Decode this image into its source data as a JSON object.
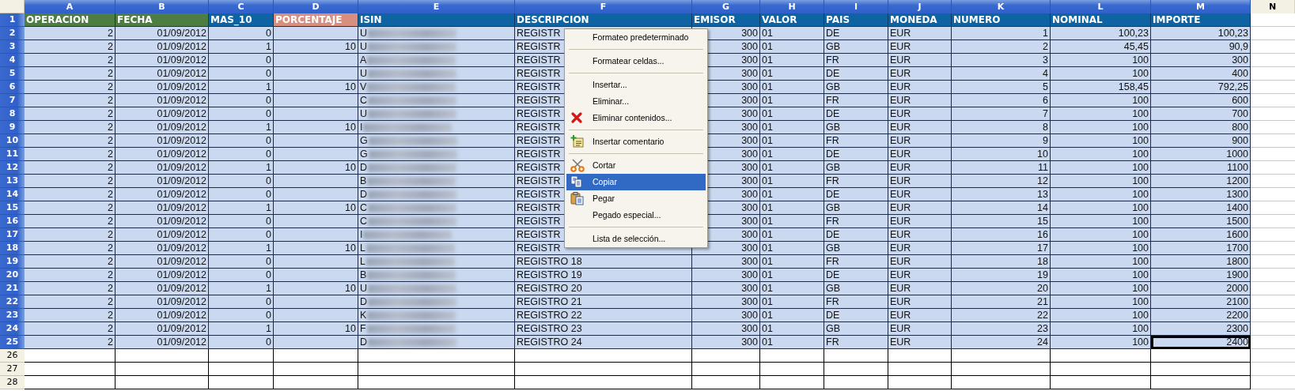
{
  "columns": [
    {
      "label": "A",
      "selected": true
    },
    {
      "label": "B",
      "selected": true
    },
    {
      "label": "C",
      "selected": true
    },
    {
      "label": "D",
      "selected": true
    },
    {
      "label": "E",
      "selected": true
    },
    {
      "label": "F",
      "selected": true
    },
    {
      "label": "G",
      "selected": true
    },
    {
      "label": "H",
      "selected": true
    },
    {
      "label": "I",
      "selected": true
    },
    {
      "label": "J",
      "selected": true
    },
    {
      "label": "K",
      "selected": true
    },
    {
      "label": "L",
      "selected": true
    },
    {
      "label": "M",
      "selected": true
    },
    {
      "label": "N",
      "selected": false
    }
  ],
  "header_row": {
    "number": "1",
    "selected": true,
    "cells": [
      {
        "text": "OPERACION",
        "color": "#4e7d44"
      },
      {
        "text": "FECHA",
        "color": "#4e7d44"
      },
      {
        "text": "MAS_10",
        "color": "#0e63a3"
      },
      {
        "text": "PORCENTAJE",
        "color": "#d98f7f"
      },
      {
        "text": "ISIN",
        "color": "#0e63a3"
      },
      {
        "text": "DESCRIPCION",
        "color": "#0e63a3"
      },
      {
        "text": "EMISOR",
        "color": "#0e63a3"
      },
      {
        "text": "VALOR",
        "color": "#0e63a3"
      },
      {
        "text": "PAIS",
        "color": "#0e63a3"
      },
      {
        "text": "MONEDA",
        "color": "#0e63a3"
      },
      {
        "text": "NUMERO",
        "color": "#0e63a3"
      },
      {
        "text": "NOMINAL",
        "color": "#0e63a3"
      },
      {
        "text": "IMPORTE",
        "color": "#0e63a3"
      }
    ]
  },
  "rows": [
    {
      "number": "2",
      "selected": true,
      "cells": [
        "2",
        "01/09/2012",
        "0",
        null,
        "U",
        "REGISTR",
        "300",
        "01",
        "DE",
        "EUR",
        "1",
        "100,23",
        "100,23"
      ]
    },
    {
      "number": "3",
      "selected": true,
      "cells": [
        "2",
        "01/09/2012",
        "1",
        "10",
        "U",
        "REGISTR",
        "300",
        "01",
        "GB",
        "EUR",
        "2",
        "45,45",
        "90,9"
      ]
    },
    {
      "number": "4",
      "selected": true,
      "cells": [
        "2",
        "01/09/2012",
        "0",
        null,
        "A",
        "REGISTR",
        "300",
        "01",
        "FR",
        "EUR",
        "3",
        "100",
        "300"
      ]
    },
    {
      "number": "5",
      "selected": true,
      "cells": [
        "2",
        "01/09/2012",
        "0",
        null,
        "U",
        "REGISTR",
        "300",
        "01",
        "DE",
        "EUR",
        "4",
        "100",
        "400"
      ]
    },
    {
      "number": "6",
      "selected": true,
      "cells": [
        "2",
        "01/09/2012",
        "1",
        "10",
        "V",
        "REGISTR",
        "300",
        "01",
        "GB",
        "EUR",
        "5",
        "158,45",
        "792,25"
      ]
    },
    {
      "number": "7",
      "selected": true,
      "cells": [
        "2",
        "01/09/2012",
        "0",
        null,
        "C",
        "REGISTR",
        "300",
        "01",
        "FR",
        "EUR",
        "6",
        "100",
        "600"
      ]
    },
    {
      "number": "8",
      "selected": true,
      "cells": [
        "2",
        "01/09/2012",
        "0",
        null,
        "U",
        "REGISTR",
        "300",
        "01",
        "DE",
        "EUR",
        "7",
        "100",
        "700"
      ]
    },
    {
      "number": "9",
      "selected": true,
      "cells": [
        "2",
        "01/09/2012",
        "1",
        "10",
        "I",
        "REGISTR",
        "300",
        "01",
        "GB",
        "EUR",
        "8",
        "100",
        "800"
      ]
    },
    {
      "number": "10",
      "selected": true,
      "cells": [
        "2",
        "01/09/2012",
        "0",
        null,
        "G",
        "REGISTR",
        "300",
        "01",
        "FR",
        "EUR",
        "9",
        "100",
        "900"
      ]
    },
    {
      "number": "11",
      "selected": true,
      "cells": [
        "2",
        "01/09/2012",
        "0",
        null,
        "G",
        "REGISTR",
        "300",
        "01",
        "DE",
        "EUR",
        "10",
        "100",
        "1000"
      ]
    },
    {
      "number": "12",
      "selected": true,
      "cells": [
        "2",
        "01/09/2012",
        "1",
        "10",
        "D",
        "REGISTR",
        "300",
        "01",
        "GB",
        "EUR",
        "11",
        "100",
        "1100"
      ]
    },
    {
      "number": "13",
      "selected": true,
      "cells": [
        "2",
        "01/09/2012",
        "0",
        null,
        "B",
        "REGISTR",
        "300",
        "01",
        "FR",
        "EUR",
        "12",
        "100",
        "1200"
      ]
    },
    {
      "number": "14",
      "selected": true,
      "cells": [
        "2",
        "01/09/2012",
        "0",
        null,
        "D",
        "REGISTR",
        "300",
        "01",
        "DE",
        "EUR",
        "13",
        "100",
        "1300"
      ]
    },
    {
      "number": "15",
      "selected": true,
      "cells": [
        "2",
        "01/09/2012",
        "1",
        "10",
        "C",
        "REGISTR",
        "300",
        "01",
        "GB",
        "EUR",
        "14",
        "100",
        "1400"
      ]
    },
    {
      "number": "16",
      "selected": true,
      "cells": [
        "2",
        "01/09/2012",
        "0",
        null,
        "C",
        "REGISTR",
        "300",
        "01",
        "FR",
        "EUR",
        "15",
        "100",
        "1500"
      ]
    },
    {
      "number": "17",
      "selected": true,
      "cells": [
        "2",
        "01/09/2012",
        "0",
        null,
        "I",
        "REGISTR",
        "300",
        "01",
        "DE",
        "EUR",
        "16",
        "100",
        "1600"
      ]
    },
    {
      "number": "18",
      "selected": true,
      "cells": [
        "2",
        "01/09/2012",
        "1",
        "10",
        "L",
        "REGISTR",
        "300",
        "01",
        "GB",
        "EUR",
        "17",
        "100",
        "1700"
      ]
    },
    {
      "number": "19",
      "selected": true,
      "cells": [
        "2",
        "01/09/2012",
        "0",
        null,
        "L",
        "REGISTRO 18",
        "300",
        "01",
        "FR",
        "EUR",
        "18",
        "100",
        "1800"
      ]
    },
    {
      "number": "20",
      "selected": true,
      "cells": [
        "2",
        "01/09/2012",
        "0",
        null,
        "B",
        "REGISTRO 19",
        "300",
        "01",
        "DE",
        "EUR",
        "19",
        "100",
        "1900"
      ]
    },
    {
      "number": "21",
      "selected": true,
      "cells": [
        "2",
        "01/09/2012",
        "1",
        "10",
        "U",
        "REGISTRO 20",
        "300",
        "01",
        "GB",
        "EUR",
        "20",
        "100",
        "2000"
      ]
    },
    {
      "number": "22",
      "selected": true,
      "cells": [
        "2",
        "01/09/2012",
        "0",
        null,
        "D",
        "REGISTRO 21",
        "300",
        "01",
        "FR",
        "EUR",
        "21",
        "100",
        "2100"
      ]
    },
    {
      "number": "23",
      "selected": true,
      "cells": [
        "2",
        "01/09/2012",
        "0",
        null,
        "K",
        "REGISTRO 22",
        "300",
        "01",
        "DE",
        "EUR",
        "22",
        "100",
        "2200"
      ]
    },
    {
      "number": "24",
      "selected": true,
      "cells": [
        "2",
        "01/09/2012",
        "1",
        "10",
        "F",
        "REGISTRO 23",
        "300",
        "01",
        "GB",
        "EUR",
        "23",
        "100",
        "2300"
      ]
    },
    {
      "number": "25",
      "selected": true,
      "cells": [
        "2",
        "01/09/2012",
        "0",
        null,
        "D",
        "REGISTRO 24",
        "300",
        "01",
        "FR",
        "EUR",
        "24",
        "100",
        {
          "text": "2400",
          "active": true
        }
      ]
    },
    {
      "number": "26",
      "selected": false,
      "cells": []
    },
    {
      "number": "27",
      "selected": false,
      "cells": []
    },
    {
      "number": "28",
      "selected": false,
      "cells": []
    }
  ],
  "context_menu": {
    "items": [
      {
        "kind": "item",
        "label": "Formateo predeterminado",
        "selected": false
      },
      {
        "kind": "separator"
      },
      {
        "kind": "item",
        "label": "Formatear celdas...",
        "selected": false
      },
      {
        "kind": "separator"
      },
      {
        "kind": "item",
        "label": "Insertar...",
        "selected": false
      },
      {
        "kind": "item",
        "label": "Eliminar...",
        "selected": false
      },
      {
        "kind": "item",
        "label": "Eliminar contenidos...",
        "selected": false
      },
      {
        "kind": "separator"
      },
      {
        "kind": "item",
        "label": "Insertar comentario",
        "selected": false
      },
      {
        "kind": "separator"
      },
      {
        "kind": "item",
        "label": "Cortar",
        "selected": false
      },
      {
        "kind": "item",
        "label": "Copiar",
        "selected": true
      },
      {
        "kind": "item",
        "label": "Pegar",
        "selected": false
      },
      {
        "kind": "item",
        "label": "Pegado especial...",
        "selected": false
      },
      {
        "kind": "separator"
      },
      {
        "kind": "item",
        "label": "Lista de selección...",
        "selected": false
      }
    ]
  }
}
